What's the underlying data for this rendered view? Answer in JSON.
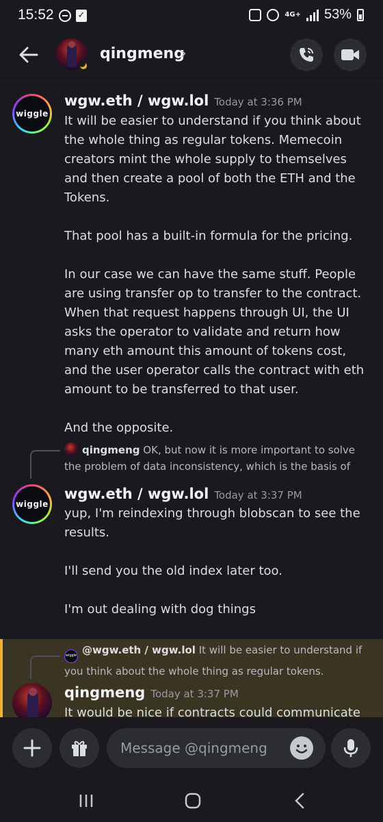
{
  "status_bar": {
    "time": "15:52",
    "network": "4G+",
    "battery": "53%"
  },
  "header": {
    "name": "qingmeng",
    "chevron": "›"
  },
  "messages": [
    {
      "author": "wgw.eth / wgw.lol",
      "timestamp": "Today at 3:36 PM",
      "avatar_text": "wiggle",
      "paragraphs": [
        "It will be easier to understand if you think about the whole thing as regular tokens. Memecoin creators mint the whole supply to themselves and then create a pool of both the ETH and the Tokens.",
        "That pool has a built-in formula for the pricing.",
        "In our case we can have the same stuff. People are using transfer op to transfer to the contract. When that request happens through UI, the UI asks the operator to validate and return how many eth amount this amount of tokens cost, and the user operator calls the contract with eth amount to be transferred to that user.",
        "And the opposite."
      ]
    },
    {
      "reply_author": "qingmeng",
      "reply_text": "OK, but now it is more important to solve the problem of data inconsistency, which is the basis of",
      "author": "wgw.eth / wgw.lol",
      "timestamp": "Today at 3:37 PM",
      "avatar_text": "wiggle",
      "paragraphs": [
        "yup, I'm reindexing through blobscan to see the results.",
        "I'll send you the old index later too.",
        "I'm out dealing with dog things"
      ]
    },
    {
      "reply_author": "@wgw.eth / wgw.lol",
      "reply_avatar_text": "wiggle",
      "reply_text": "It will be easier to understand if you think about the whole thing as regular tokens.",
      "author": "qingmeng",
      "timestamp": "Today at 3:37 PM",
      "paragraphs": [
        "It would be nice if contracts could communicate"
      ]
    }
  ],
  "composer": {
    "placeholder": "Message @qingmeng"
  },
  "colors": {
    "background": "#1a1a1e",
    "mention_highlight": "#3a3522",
    "mention_bar": "#f0b232",
    "button_bg": "#2b2d31"
  }
}
